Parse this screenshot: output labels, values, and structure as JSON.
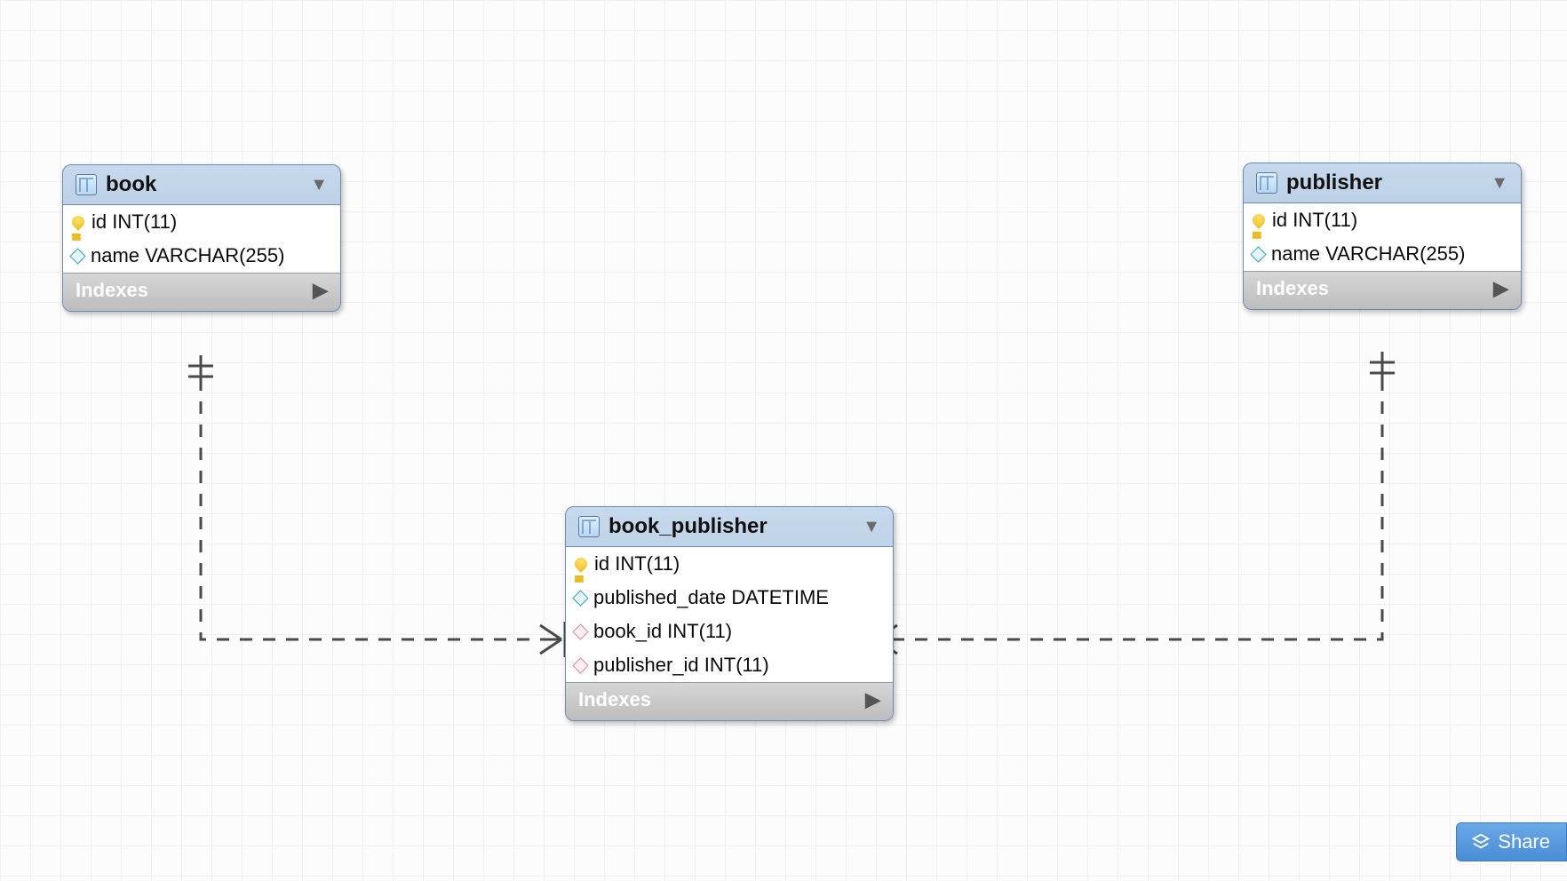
{
  "tables": {
    "book": {
      "name": "book",
      "columns": [
        {
          "icon": "key",
          "label": "id INT(11)"
        },
        {
          "icon": "diamond-blue",
          "label": "name VARCHAR(255)"
        }
      ],
      "indexes_label": "Indexes"
    },
    "publisher": {
      "name": "publisher",
      "columns": [
        {
          "icon": "key",
          "label": "id INT(11)"
        },
        {
          "icon": "diamond-blue",
          "label": "name VARCHAR(255)"
        }
      ],
      "indexes_label": "Indexes"
    },
    "book_publisher": {
      "name": "book_publisher",
      "columns": [
        {
          "icon": "key",
          "label": "id INT(11)"
        },
        {
          "icon": "diamond-blue",
          "label": "published_date DATETIME"
        },
        {
          "icon": "diamond-pink",
          "label": "book_id INT(11)"
        },
        {
          "icon": "diamond-pink",
          "label": "publisher_id INT(11)"
        }
      ],
      "indexes_label": "Indexes"
    }
  },
  "share_button": {
    "label": "Share"
  }
}
